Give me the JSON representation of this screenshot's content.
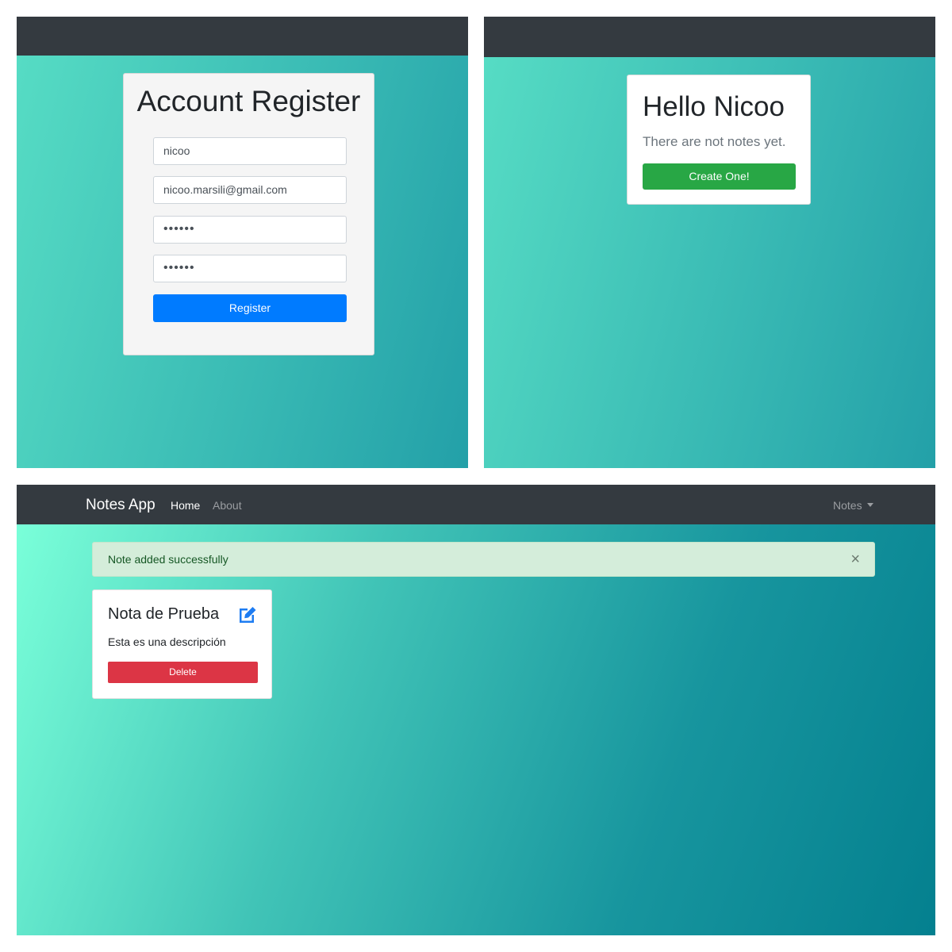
{
  "register": {
    "title": "Account Register",
    "username_value": "nicoo",
    "email_value": "nicoo.marsili@gmail.com",
    "password_value": "••••••",
    "confirm_password_value": "••••••",
    "register_button": "Register",
    "button_color": "#007bff"
  },
  "empty_notes": {
    "greeting": "Hello Nicoo",
    "message": "There are not notes yet.",
    "create_button": "Create One!",
    "button_color": "#28a745"
  },
  "notes_page": {
    "navbar": {
      "brand": "Notes App",
      "links": [
        "Home",
        "About"
      ],
      "active_link": "Home",
      "dropdown_label": "Notes",
      "dropdown_icon": "caret-down-icon"
    },
    "alert": {
      "message": "Note added successfully",
      "close_symbol": "×",
      "color": "#d4edda"
    },
    "note": {
      "title": "Nota de Prueba",
      "edit_icon": "edit-icon",
      "description": "Esta es una descripción",
      "delete_button": "Delete",
      "delete_color": "#dc3545"
    }
  }
}
